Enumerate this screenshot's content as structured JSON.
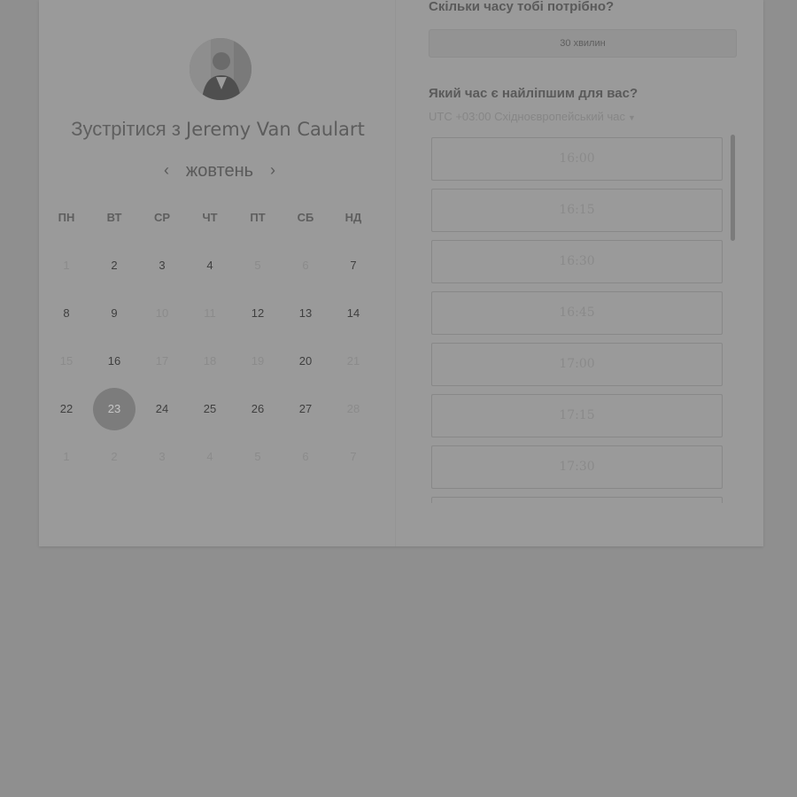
{
  "host": {
    "title_prefix": "Зустрітися з",
    "name": "Jeremy Van Caulart"
  },
  "calendar": {
    "month": "жовтень",
    "prev_icon": "chevron-left-icon",
    "next_icon": "chevron-right-icon",
    "weekdays": [
      "ПН",
      "ВТ",
      "СР",
      "ЧТ",
      "ПТ",
      "СБ",
      "НД"
    ],
    "weeks": [
      [
        {
          "d": "1",
          "s": "dim"
        },
        {
          "d": "2",
          "s": "on"
        },
        {
          "d": "3",
          "s": "on"
        },
        {
          "d": "4",
          "s": "on"
        },
        {
          "d": "5",
          "s": "dim"
        },
        {
          "d": "6",
          "s": "dim"
        },
        {
          "d": "7",
          "s": "on"
        }
      ],
      [
        {
          "d": "8",
          "s": "on"
        },
        {
          "d": "9",
          "s": "on"
        },
        {
          "d": "10",
          "s": "dim"
        },
        {
          "d": "11",
          "s": "dim"
        },
        {
          "d": "12",
          "s": "on"
        },
        {
          "d": "13",
          "s": "on"
        },
        {
          "d": "14",
          "s": "on"
        }
      ],
      [
        {
          "d": "15",
          "s": "dim"
        },
        {
          "d": "16",
          "s": "on"
        },
        {
          "d": "17",
          "s": "dim"
        },
        {
          "d": "18",
          "s": "dim"
        },
        {
          "d": "19",
          "s": "dim"
        },
        {
          "d": "20",
          "s": "on"
        },
        {
          "d": "21",
          "s": "dim"
        }
      ],
      [
        {
          "d": "22",
          "s": "on"
        },
        {
          "d": "23",
          "s": "sel"
        },
        {
          "d": "24",
          "s": "on"
        },
        {
          "d": "25",
          "s": "on"
        },
        {
          "d": "26",
          "s": "on"
        },
        {
          "d": "27",
          "s": "on"
        },
        {
          "d": "28",
          "s": "dim"
        }
      ],
      [
        {
          "d": "1",
          "s": "dim"
        },
        {
          "d": "2",
          "s": "dim"
        },
        {
          "d": "3",
          "s": "dim"
        },
        {
          "d": "4",
          "s": "dim"
        },
        {
          "d": "5",
          "s": "dim"
        },
        {
          "d": "6",
          "s": "dim"
        },
        {
          "d": "7",
          "s": "dim"
        }
      ]
    ]
  },
  "booking": {
    "duration_question": "Скільки часу тобі потрібно?",
    "duration_value": "30 хвилин",
    "time_question": "Який час є найліпшим для вас?",
    "timezone": "UTC +03:00 Східноєвропейський час",
    "timezone_icon": "caret-down-icon",
    "slots": [
      "16:00",
      "16:15",
      "16:30",
      "16:45",
      "17:00",
      "17:15",
      "17:30",
      ""
    ]
  },
  "colors": {
    "overlay": "#8f8f8f",
    "card": "#9a9a9a",
    "selected_day": "#7c7c7c"
  }
}
